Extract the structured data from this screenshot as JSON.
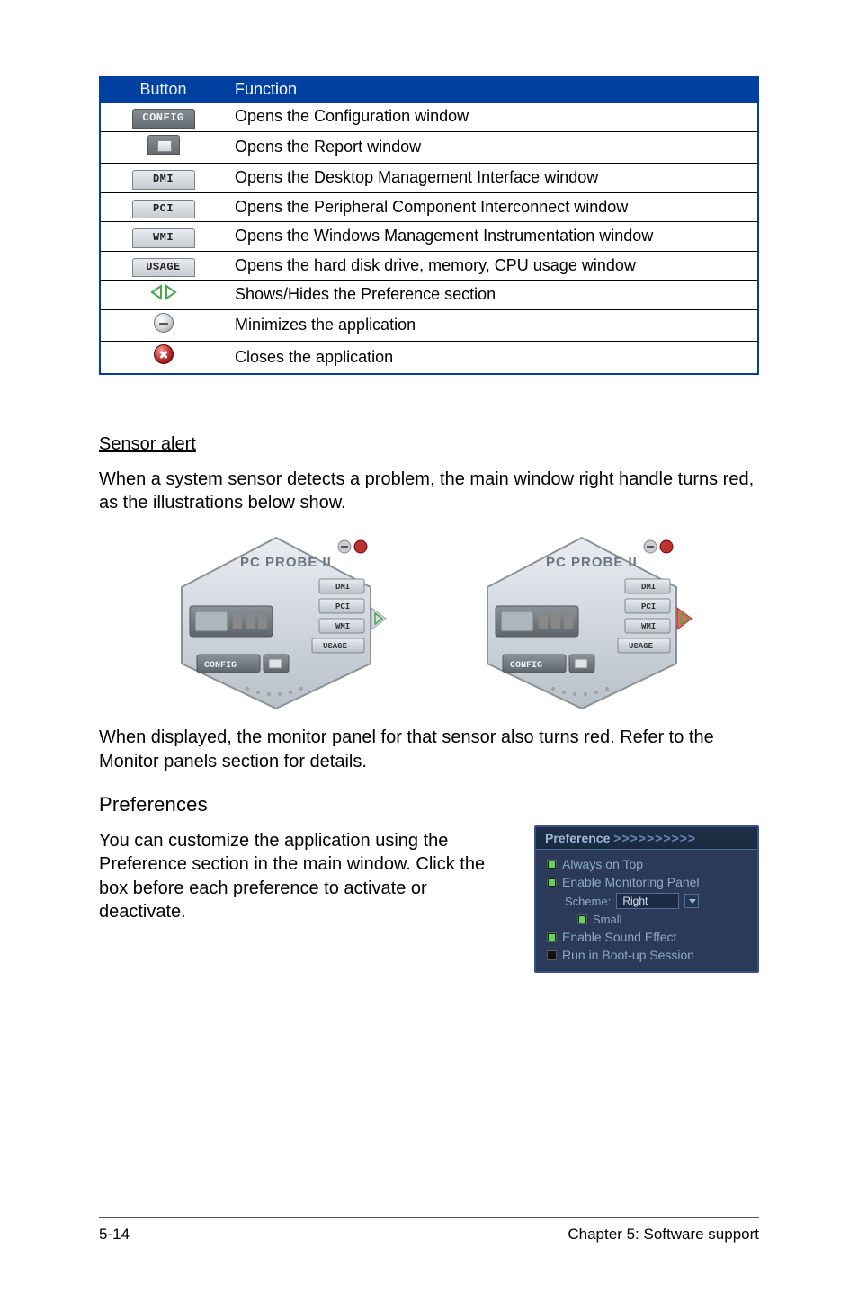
{
  "table": {
    "headers": {
      "button": "Button",
      "function": "Function"
    },
    "rows": [
      {
        "icon": "config",
        "label": "CONFIG",
        "function": "Opens the Configuration window"
      },
      {
        "icon": "report",
        "label": "",
        "function": "Opens the Report window"
      },
      {
        "icon": "dmi",
        "label": "DMI",
        "function": "Opens the Desktop Management Interface window"
      },
      {
        "icon": "pci",
        "label": "PCI",
        "function": "Opens the Peripheral Component Interconnect window"
      },
      {
        "icon": "wmi",
        "label": "WMI",
        "function": "Opens the Windows Management Instrumentation window"
      },
      {
        "icon": "usage",
        "label": "USAGE",
        "function": "Opens the hard disk drive, memory, CPU usage window"
      },
      {
        "icon": "tri",
        "label": "",
        "function": "Shows/Hides the Preference section"
      },
      {
        "icon": "min",
        "label": "",
        "function": "Minimizes the application"
      },
      {
        "icon": "close",
        "label": "",
        "function": "Closes the application"
      }
    ]
  },
  "sensor": {
    "heading": "Sensor alert",
    "p1": "When a system sensor detects a problem, the main window right handle turns red, as the illustrations below show.",
    "p2": "When displayed, the monitor panel for that sensor also turns red. Refer to the Monitor panels section for details."
  },
  "hex": {
    "title": "PC PROBE II",
    "tabs": {
      "dmi": "DMI",
      "pci": "PCI",
      "wmi": "WMI",
      "usage": "USAGE",
      "config": "CONFIG"
    }
  },
  "prefs": {
    "heading": "Preferences",
    "p": "You can customize the application using the Preference section in the main window. Click the box before each preference to activate or deactivate.",
    "panel": {
      "title": "Preference",
      "chev": ">>>>>>>>>>",
      "items": {
        "alwaysOnTop": "Always on Top",
        "enableMonitoring": "Enable Monitoring Panel",
        "scheme_label": "Scheme:",
        "scheme_value": "Right",
        "small": "Small",
        "enableSound": "Enable Sound Effect",
        "runBoot": "Run in Boot-up Session"
      }
    }
  },
  "footer": {
    "left": "5-14",
    "right": "Chapter 5: Software support"
  }
}
